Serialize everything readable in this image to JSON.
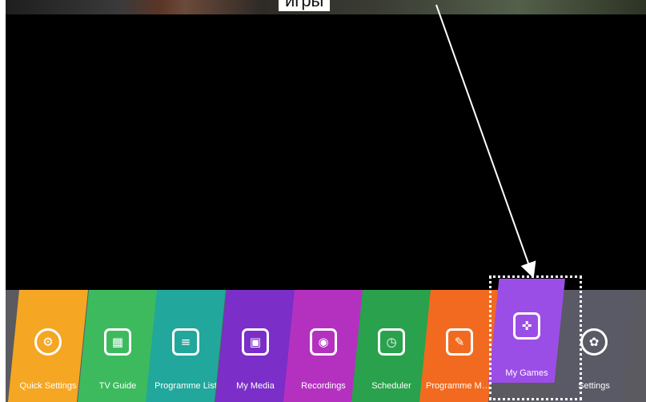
{
  "annotation": {
    "caption": "игры",
    "colors": {
      "arrow": "#ffffff",
      "box": "#ffffff"
    }
  },
  "launcher": {
    "items": [
      {
        "label": "Quick Settings",
        "icon": "quick-settings-icon",
        "color": "#f5a623"
      },
      {
        "label": "TV Guide",
        "icon": "tv-guide-icon",
        "color": "#3dba5e"
      },
      {
        "label": "Programme List",
        "icon": "programme-list-icon",
        "color": "#21a79b"
      },
      {
        "label": "My Media",
        "icon": "my-media-icon",
        "color": "#7b2ec8"
      },
      {
        "label": "Recordings",
        "icon": "recordings-icon",
        "color": "#b431c0"
      },
      {
        "label": "Scheduler",
        "icon": "scheduler-icon",
        "color": "#2aa14c"
      },
      {
        "label": "Programme Ma...",
        "icon": "programme-manager-icon",
        "color": "#f26a1f"
      },
      {
        "label": "My Games",
        "icon": "gamepad-icon",
        "color": "#9b4ee6",
        "selected": true
      },
      {
        "label": "Settings",
        "icon": "gear-icon",
        "color": "#5a5a66"
      }
    ]
  }
}
